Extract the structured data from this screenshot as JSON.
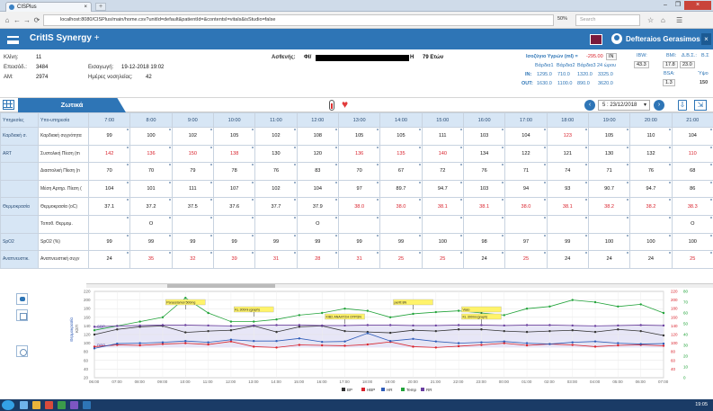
{
  "browser": {
    "tab_title": "CISPlus",
    "tab_close": "×",
    "new_tab": "+",
    "url": "localhost:8080/CISPlus/main/home.csv?unitId=default&patientId=&contentsI=vitals&isStudio=false",
    "zoom": "50%",
    "search_placeholder": "Search",
    "window_close": "×",
    "window_minimize": "–",
    "window_maximize": "❐",
    "back": "←",
    "forward": "→",
    "reload": "⟳",
    "home": "⌂",
    "star_icon": "☆",
    "home_icon": "⌂",
    "menu_icon": "☰"
  },
  "app": {
    "name": "CritIS Synergy",
    "name_suffix": "+",
    "user": "Defteraios Gerasimos",
    "close": "×"
  },
  "patient": {
    "bed_label": "Κλίνη:",
    "bed": "11",
    "adm_label": "Εισαγωγή:",
    "adm": "19-12-2018 19:02",
    "epis_label": "Επεισόδ.:",
    "epis": "3484",
    "days_label": "Ημέρες νοσηλείας:",
    "days": "42",
    "am_label": "ΑΜ:",
    "am": "2974",
    "name_label": "Ασθενής:",
    "name_prefix": "ΦΙ/",
    "name_suffix": "Η",
    "age": "79 Ετών"
  },
  "fluid": {
    "title": "Ισοζύγιο Υγρών (ml) =",
    "total": "-295.00",
    "cols": [
      "Βάρδια1",
      "Βάρδια2",
      "Βάρδια3",
      "24 ώρου"
    ],
    "in_label": "IN:",
    "in": [
      "1295.0",
      "710.0",
      "1320.0",
      "3325.0"
    ],
    "out_label": "OUT:",
    "out": [
      "1630.0",
      "1100.0",
      "890.0",
      "3620.0"
    ],
    "box_label": "IN",
    "stats": {
      "ibw_label": "IBW:",
      "ibw": "43.3",
      "bmi_label": "BMI:",
      "bmi": "17.8",
      "bsa_label": "BSA:",
      "bsa": "1.3",
      "bee_label": "Δ.Β.Σ.:",
      "bee": "23.0",
      "b2_label": "Β.Σ",
      "h_label": "Ύψο",
      "h": "150"
    }
  },
  "toolbar": {
    "tab_label": "Ζωτικά",
    "date": "5 : 23/12/2018",
    "prev": "‹",
    "next": "›",
    "dropdown": "▾",
    "download_icon": "⇩",
    "export_icon": "⇲"
  },
  "grid": {
    "headers": [
      "Υπηρεσίες",
      "Υπο-υπηρεσία",
      "7:00",
      "8:00",
      "9:00",
      "10:00",
      "11:00",
      "12:00",
      "13:00",
      "14:00",
      "15:00",
      "16:00",
      "17:00",
      "18:00",
      "19:00",
      "20:00",
      "21:00"
    ],
    "rows": [
      {
        "cat": "Καρδιακή σ.",
        "sub": "Καρδιακή συχνότητα",
        "values": [
          "99",
          "100",
          "102",
          "105",
          "102",
          "108",
          "105",
          "105",
          "111",
          "103",
          "104",
          "123",
          "105",
          "110",
          "104"
        ],
        "red": [
          11
        ]
      },
      {
        "cat": "ART",
        "sub": "Συστολική Πίεση (m",
        "values": [
          "142",
          "136",
          "150",
          "138",
          "130",
          "120",
          "136",
          "135",
          "140",
          "134",
          "122",
          "121",
          "130",
          "132",
          "110"
        ],
        "red": [
          0,
          1,
          2,
          3,
          6,
          7,
          8,
          14
        ]
      },
      {
        "cat": "",
        "sub": "Διαστολική Πίεση (n",
        "values": [
          "70",
          "70",
          "79",
          "78",
          "76",
          "83",
          "70",
          "67",
          "72",
          "76",
          "71",
          "74",
          "71",
          "76",
          "68"
        ],
        "red": []
      },
      {
        "cat": "",
        "sub": "Μέση Αρτηρ. Πίεση (",
        "values": [
          "104",
          "101",
          "111",
          "107",
          "102",
          "104",
          "97",
          "89.7",
          "94.7",
          "103",
          "94",
          "93",
          "90.7",
          "94.7",
          "86"
        ],
        "red": []
      },
      {
        "cat": "Θερμοκρασία",
        "sub": "Θερμοκρασία (oC)",
        "values": [
          "37.1",
          "37.2",
          "37.5",
          "37.6",
          "37.7",
          "37.9",
          "38.0",
          "38.0",
          "38.1",
          "38.1",
          "38.0",
          "38.1",
          "38.2",
          "38.2",
          "38.3"
        ],
        "red": [
          6,
          7,
          8,
          9,
          10,
          11,
          12,
          13,
          14
        ]
      },
      {
        "cat": "",
        "sub": "Τοποθ. Θερμομ.",
        "values": [
          "",
          "O",
          "",
          "",
          "",
          "O",
          "",
          "",
          "",
          "",
          "",
          "",
          "",
          "",
          "O"
        ],
        "red": []
      },
      {
        "cat": "SpO2",
        "sub": "SpO2 (%)",
        "values": [
          "99",
          "99",
          "99",
          "99",
          "99",
          "99",
          "99",
          "99",
          "100",
          "98",
          "97",
          "99",
          "100",
          "100",
          "100"
        ],
        "red": []
      },
      {
        "cat": "Αναπνευστικ.",
        "sub": "Αναπνευστική συχν",
        "values": [
          "24",
          "35",
          "32",
          "39",
          "31",
          "28",
          "31",
          "25",
          "25",
          "24",
          "25",
          "24",
          "24",
          "24",
          "25"
        ],
        "red": [
          1,
          2,
          3,
          4,
          5,
          6,
          7,
          8,
          10,
          14
        ]
      }
    ]
  },
  "chart_data": {
    "type": "line",
    "x": [
      "06:00",
      "07:00",
      "08:00",
      "09:00",
      "10:00",
      "11:00",
      "12:00",
      "13:00",
      "14:00",
      "15:00",
      "16:00",
      "17:00",
      "18:00",
      "19:00",
      "20:00",
      "21:00",
      "22:00",
      "23:00",
      "00:00",
      "01:00",
      "02:00",
      "03:00",
      "04:00",
      "05:00",
      "06:00",
      "07:00"
    ],
    "ylabel": "Θερμοκρασία",
    "ylabel2": "ΚΣΠ",
    "ylim": [
      20,
      220
    ],
    "yticks": [
      20,
      40,
      60,
      80,
      100,
      120,
      140,
      160,
      180,
      200,
      220
    ],
    "right_ticks_red": [
      40,
      60,
      80,
      100,
      120,
      140,
      160,
      180,
      200,
      220
    ],
    "right_ticks_green": [
      0,
      10,
      20,
      30,
      40,
      50,
      60,
      70,
      80
    ],
    "band_labels": [
      "SBP",
      "DBP"
    ],
    "series": [
      {
        "name": "BP",
        "color": "#333333",
        "values": [
          120,
          132,
          138,
          140,
          125,
          128,
          130,
          140,
          126,
          138,
          140,
          128,
          126,
          124,
          130,
          128,
          132,
          132,
          128,
          126,
          128,
          130,
          126,
          132,
          128,
          118
        ]
      },
      {
        "name": "HBP",
        "color": "#d9232d",
        "values": [
          92,
          96,
          95,
          98,
          100,
          97,
          104,
          92,
          90,
          96,
          95,
          94,
          97,
          103,
          92,
          90,
          93,
          96,
          100,
          95,
          98,
          96,
          92,
          95,
          96,
          94
        ]
      },
      {
        "name": "HR",
        "color": "#2e5cb8",
        "values": [
          88,
          99,
          100,
          102,
          105,
          102,
          108,
          105,
          105,
          111,
          103,
          104,
          123,
          105,
          110,
          104,
          100,
          102,
          104,
          100,
          98,
          102,
          104,
          100,
          98,
          99
        ]
      },
      {
        "name": "Temp",
        "color": "#22a33a",
        "values": [
          130,
          140,
          150,
          160,
          205,
          170,
          150,
          150,
          155,
          165,
          170,
          180,
          175,
          160,
          168,
          172,
          175,
          170,
          165,
          180,
          185,
          200,
          195,
          185,
          190,
          170
        ]
      },
      {
        "name": "RR",
        "color": "#6a3fa0",
        "values": [
          138,
          140,
          141,
          142,
          142,
          141,
          140,
          141,
          142,
          142,
          141,
          141,
          142,
          142,
          141,
          141,
          142,
          142,
          141,
          142,
          142,
          141,
          140,
          141,
          142,
          141
        ]
      }
    ],
    "annotations": [
      {
        "text": "Paracetamol 500mg",
        "x": "10:00"
      },
      {
        "text": "KL 300ml (graph)",
        "x": "13:00"
      },
      {
        "text": "ΚΙΒΣ ΑΝΑΛΥΣΗ ΟΥΡΩΝ",
        "x": "17:00"
      },
      {
        "text": "peritt 8N",
        "x": "20:00"
      },
      {
        "text": "Vaso",
        "x": "23:00"
      },
      {
        "text": "KL 300ml (graph)",
        "x": "23:00"
      }
    ],
    "legend": [
      "BP",
      "HBP",
      "HR",
      "Temp",
      "RR"
    ]
  },
  "taskbar": {
    "clock": "19:05"
  }
}
